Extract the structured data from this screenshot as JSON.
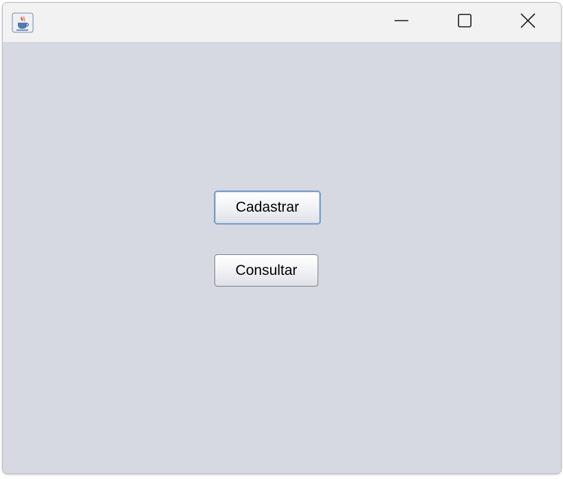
{
  "window": {
    "title": "",
    "icon": "java-coffee-cup-icon",
    "controls": {
      "minimize_icon": "minimize-icon",
      "maximize_icon": "maximize-icon",
      "close_icon": "close-icon"
    }
  },
  "main": {
    "buttons": [
      {
        "label": "Cadastrar",
        "focused": true
      },
      {
        "label": "Consultar",
        "focused": false
      }
    ]
  },
  "colors": {
    "titlebar": "#f2f2f3",
    "client_background": "#d6d9e1",
    "focus_ring": "#8aaed6"
  }
}
